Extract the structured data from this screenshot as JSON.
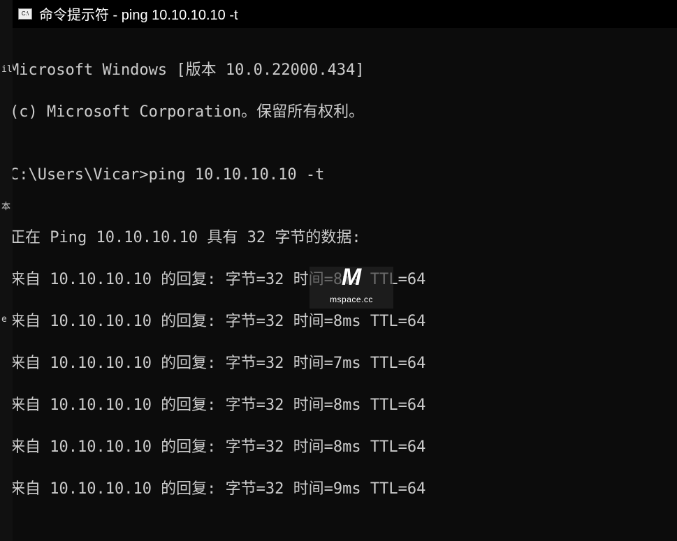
{
  "titlebar": {
    "title": "命令提示符 - ping  10.10.10.10 -t"
  },
  "terminal": {
    "line_version": "Microsoft Windows [版本 10.0.22000.434]",
    "line_copyright": "(c) Microsoft Corporation。保留所有权利。",
    "blank1": "",
    "prompt_line": "C:\\Users\\Vicar>ping 10.10.10.10 -t",
    "blank2": "",
    "ping_header": "正在 Ping 10.10.10.10 具有 32 字节的数据:",
    "replies": [
      "来自 10.10.10.10 的回复: 字节=32 时间=8ms TTL=64",
      "来自 10.10.10.10 的回复: 字节=32 时间=8ms TTL=64",
      "来自 10.10.10.10 的回复: 字节=32 时间=7ms TTL=64",
      "来自 10.10.10.10 的回复: 字节=32 时间=8ms TTL=64",
      "来自 10.10.10.10 的回复: 字节=32 时间=8ms TTL=64",
      "来自 10.10.10.10 的回复: 字节=32 时间=9ms TTL=64"
    ]
  },
  "watermark": {
    "logo": "M",
    "text": "mspace.cc"
  },
  "edge": {
    "frag1": "il",
    "frag2": "本",
    "frag3": "e"
  }
}
